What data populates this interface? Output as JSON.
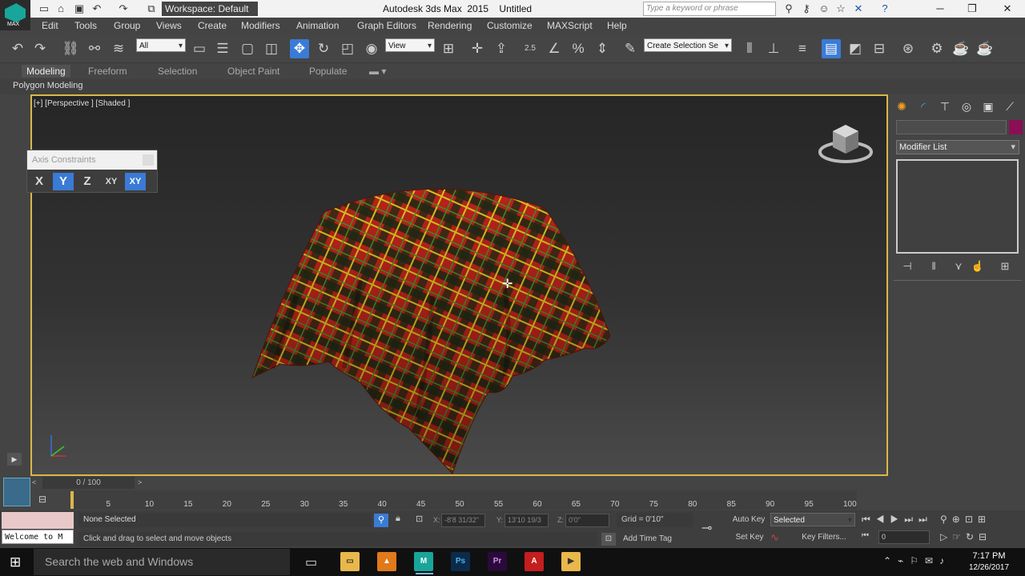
{
  "app": {
    "title": "Autodesk 3ds Max  2015    Untitled",
    "logo_text": "MAX",
    "workspace": "Workspace: Default",
    "search_placeholder": "Type a keyword or phrase"
  },
  "menu": [
    "Edit",
    "Tools",
    "Group",
    "Views",
    "Create",
    "Modifiers",
    "Animation",
    "Graph Editors",
    "Rendering",
    "Customize",
    "MAXScript",
    "Help"
  ],
  "toolbar": {
    "filter_dropdown": "All",
    "ref_coord_dropdown": "View",
    "selection_set_dropdown": "Create Selection Se",
    "snap_label": "2.5"
  },
  "ribbon": {
    "tabs": [
      "Modeling",
      "Freeform",
      "Selection",
      "Object Paint",
      "Populate"
    ],
    "active_tab": "Modeling",
    "sub_label": "Polygon Modeling"
  },
  "viewport": {
    "label": "[+] [Perspective ] [Shaded ]",
    "axis_constraints_title": "Axis Constraints",
    "axis_buttons": [
      "X",
      "Y",
      "Z",
      "XY",
      "XY"
    ]
  },
  "command_panel": {
    "modifier_list": "Modifier List",
    "swatch_color": "#8a0f55"
  },
  "timeline": {
    "frame": "0 / 100",
    "ticks": [
      "5",
      "10",
      "15",
      "20",
      "25",
      "30",
      "35",
      "40",
      "45",
      "50",
      "55",
      "60",
      "65",
      "70",
      "75",
      "80",
      "85",
      "90",
      "95",
      "100"
    ]
  },
  "status": {
    "maxscript": "Welcome to M",
    "selection": "None Selected",
    "prompt": "Click and drag to select and move objects",
    "x_label": "X:",
    "x_value": "-8'8 31/32\"",
    "y_label": "Y:",
    "y_value": "13'10 19/3",
    "z_label": "Z:",
    "z_value": "0'0\"",
    "grid": "Grid = 0'10\"",
    "add_time_tag": "Add Time Tag",
    "auto_key": "Auto Key",
    "set_key": "Set Key",
    "key_mode": "Selected",
    "key_filters": "Key Filters...",
    "frame_field": "0"
  },
  "taskbar": {
    "search": "Search the web and Windows",
    "time": "7:17 PM",
    "date": "12/26/2017"
  }
}
